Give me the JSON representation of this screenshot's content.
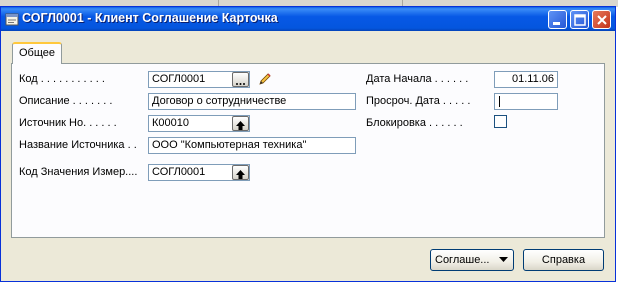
{
  "window": {
    "title": "СОГЛ0001 - Клиент Соглашение Карточка"
  },
  "tabs": [
    {
      "label": "Общее",
      "active": true
    }
  ],
  "form": {
    "left": [
      {
        "label": "Код . . . . . . . . . . .",
        "value": "СОГЛ0001",
        "control": "assist-edit"
      },
      {
        "label": "Описание . . . . . . .",
        "value": "Договор о сотрудничестве",
        "control": "text"
      },
      {
        "label": "Источник Но. . . . . .",
        "value": "К00010",
        "control": "lookup"
      },
      {
        "label": "Название Источника . .",
        "value": "ООО \"Компьютерная техника\"",
        "control": "text"
      },
      {
        "label": "Код Значения Измер....",
        "value": "СОГЛ0001",
        "control": "lookup"
      }
    ],
    "right": [
      {
        "label": "Дата Начала . . . . . .",
        "value": "01.11.06",
        "control": "text"
      },
      {
        "label": "Просроч. Дата . . . . .",
        "value": "",
        "control": "text-focused"
      },
      {
        "label": "Блокировка . . . . . .",
        "checked": false,
        "control": "checkbox"
      }
    ]
  },
  "buttons": {
    "agreement": "Соглаше...",
    "help": "Справка"
  },
  "colors": {
    "title_bar": "#0558e2",
    "dialog_bg": "#ece9d8",
    "panel_bg": "#fcfcfe",
    "tab_highlight": "#ffc83c"
  }
}
